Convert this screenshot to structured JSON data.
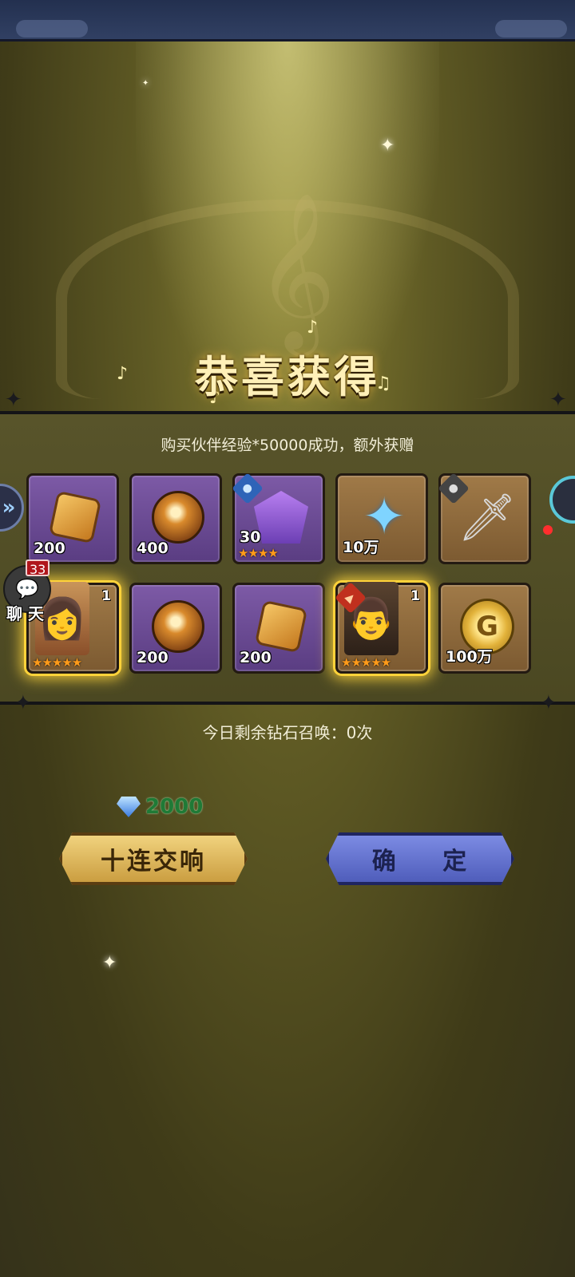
{
  "header": {
    "title": "恭喜获得"
  },
  "panel": {
    "message": "购买伙伴经验*50000成功，额外获赠",
    "items": [
      {
        "name": "ore-shard",
        "qty": "200",
        "count": "",
        "stars": "",
        "frame": "purple"
      },
      {
        "name": "fire-orb",
        "qty": "400",
        "count": "",
        "stars": "",
        "frame": "purple"
      },
      {
        "name": "hero-shard",
        "qty": "30",
        "count": "",
        "stars": "★★★★",
        "frame": "purple"
      },
      {
        "name": "exp-star",
        "qty": "10万",
        "count": "",
        "stars": "",
        "frame": "brown"
      },
      {
        "name": "sword",
        "qty": "",
        "count": "",
        "stars": "",
        "frame": "brown"
      },
      {
        "name": "hero-woman",
        "qty": "",
        "count": "1",
        "stars": "★★★★★",
        "frame": "gold"
      },
      {
        "name": "fire-orb",
        "qty": "200",
        "count": "",
        "stars": "",
        "frame": "purple"
      },
      {
        "name": "ore-shard",
        "qty": "200",
        "count": "",
        "stars": "",
        "frame": "purple"
      },
      {
        "name": "hero-man",
        "qty": "",
        "count": "1",
        "stars": "★★★★★",
        "frame": "gold"
      },
      {
        "name": "gold-coin",
        "qty": "100万",
        "count": "",
        "stars": "",
        "frame": "brown"
      }
    ]
  },
  "chat": {
    "count": "33",
    "label": "聊 天"
  },
  "summon": {
    "remaining_text": "今日剩余钻石召唤：0次"
  },
  "currency": {
    "diamond_value": "2000",
    "icon": "diamond-icon"
  },
  "buttons": {
    "ten_pull": "十连交响",
    "confirm": "确 定"
  },
  "colors": {
    "gold_button": "#e3bd5f",
    "blue_button": "#6472cc",
    "accent_gold": "#ffd23a"
  }
}
